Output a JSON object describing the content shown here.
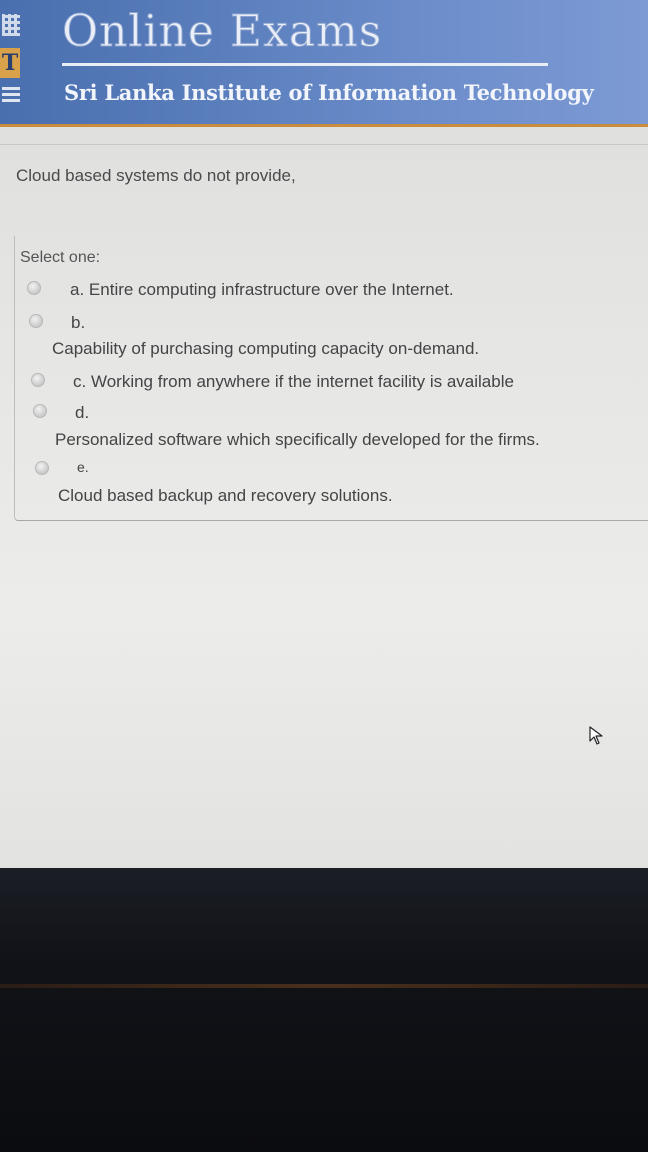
{
  "header": {
    "app_title": "Online Exams",
    "institute": "Sri Lanka Institute of Information Technology",
    "logo_letter": "T"
  },
  "question": {
    "text": "Cloud based systems do not provide,",
    "prompt": "Select one:",
    "options": [
      {
        "letter": "a.",
        "text": "Entire computing infrastructure over the Internet.",
        "selected": false
      },
      {
        "letter": "b.",
        "text": "Capability of purchasing computing capacity on-demand.",
        "selected": false
      },
      {
        "letter": "c.",
        "text": "Working from anywhere if the internet facility is available",
        "selected": false
      },
      {
        "letter": "d.",
        "text": "Personalized software which specifically developed for the firms.",
        "selected": false
      },
      {
        "letter": "e.",
        "text": "Cloud based backup and recovery solutions.",
        "selected": false
      }
    ]
  },
  "colors": {
    "header_blue": "#5b7fbd",
    "accent_orange": "#c98b3c",
    "page_bg": "#e6e6e4"
  },
  "icons": {
    "cursor": "mouse-pointer-icon"
  }
}
